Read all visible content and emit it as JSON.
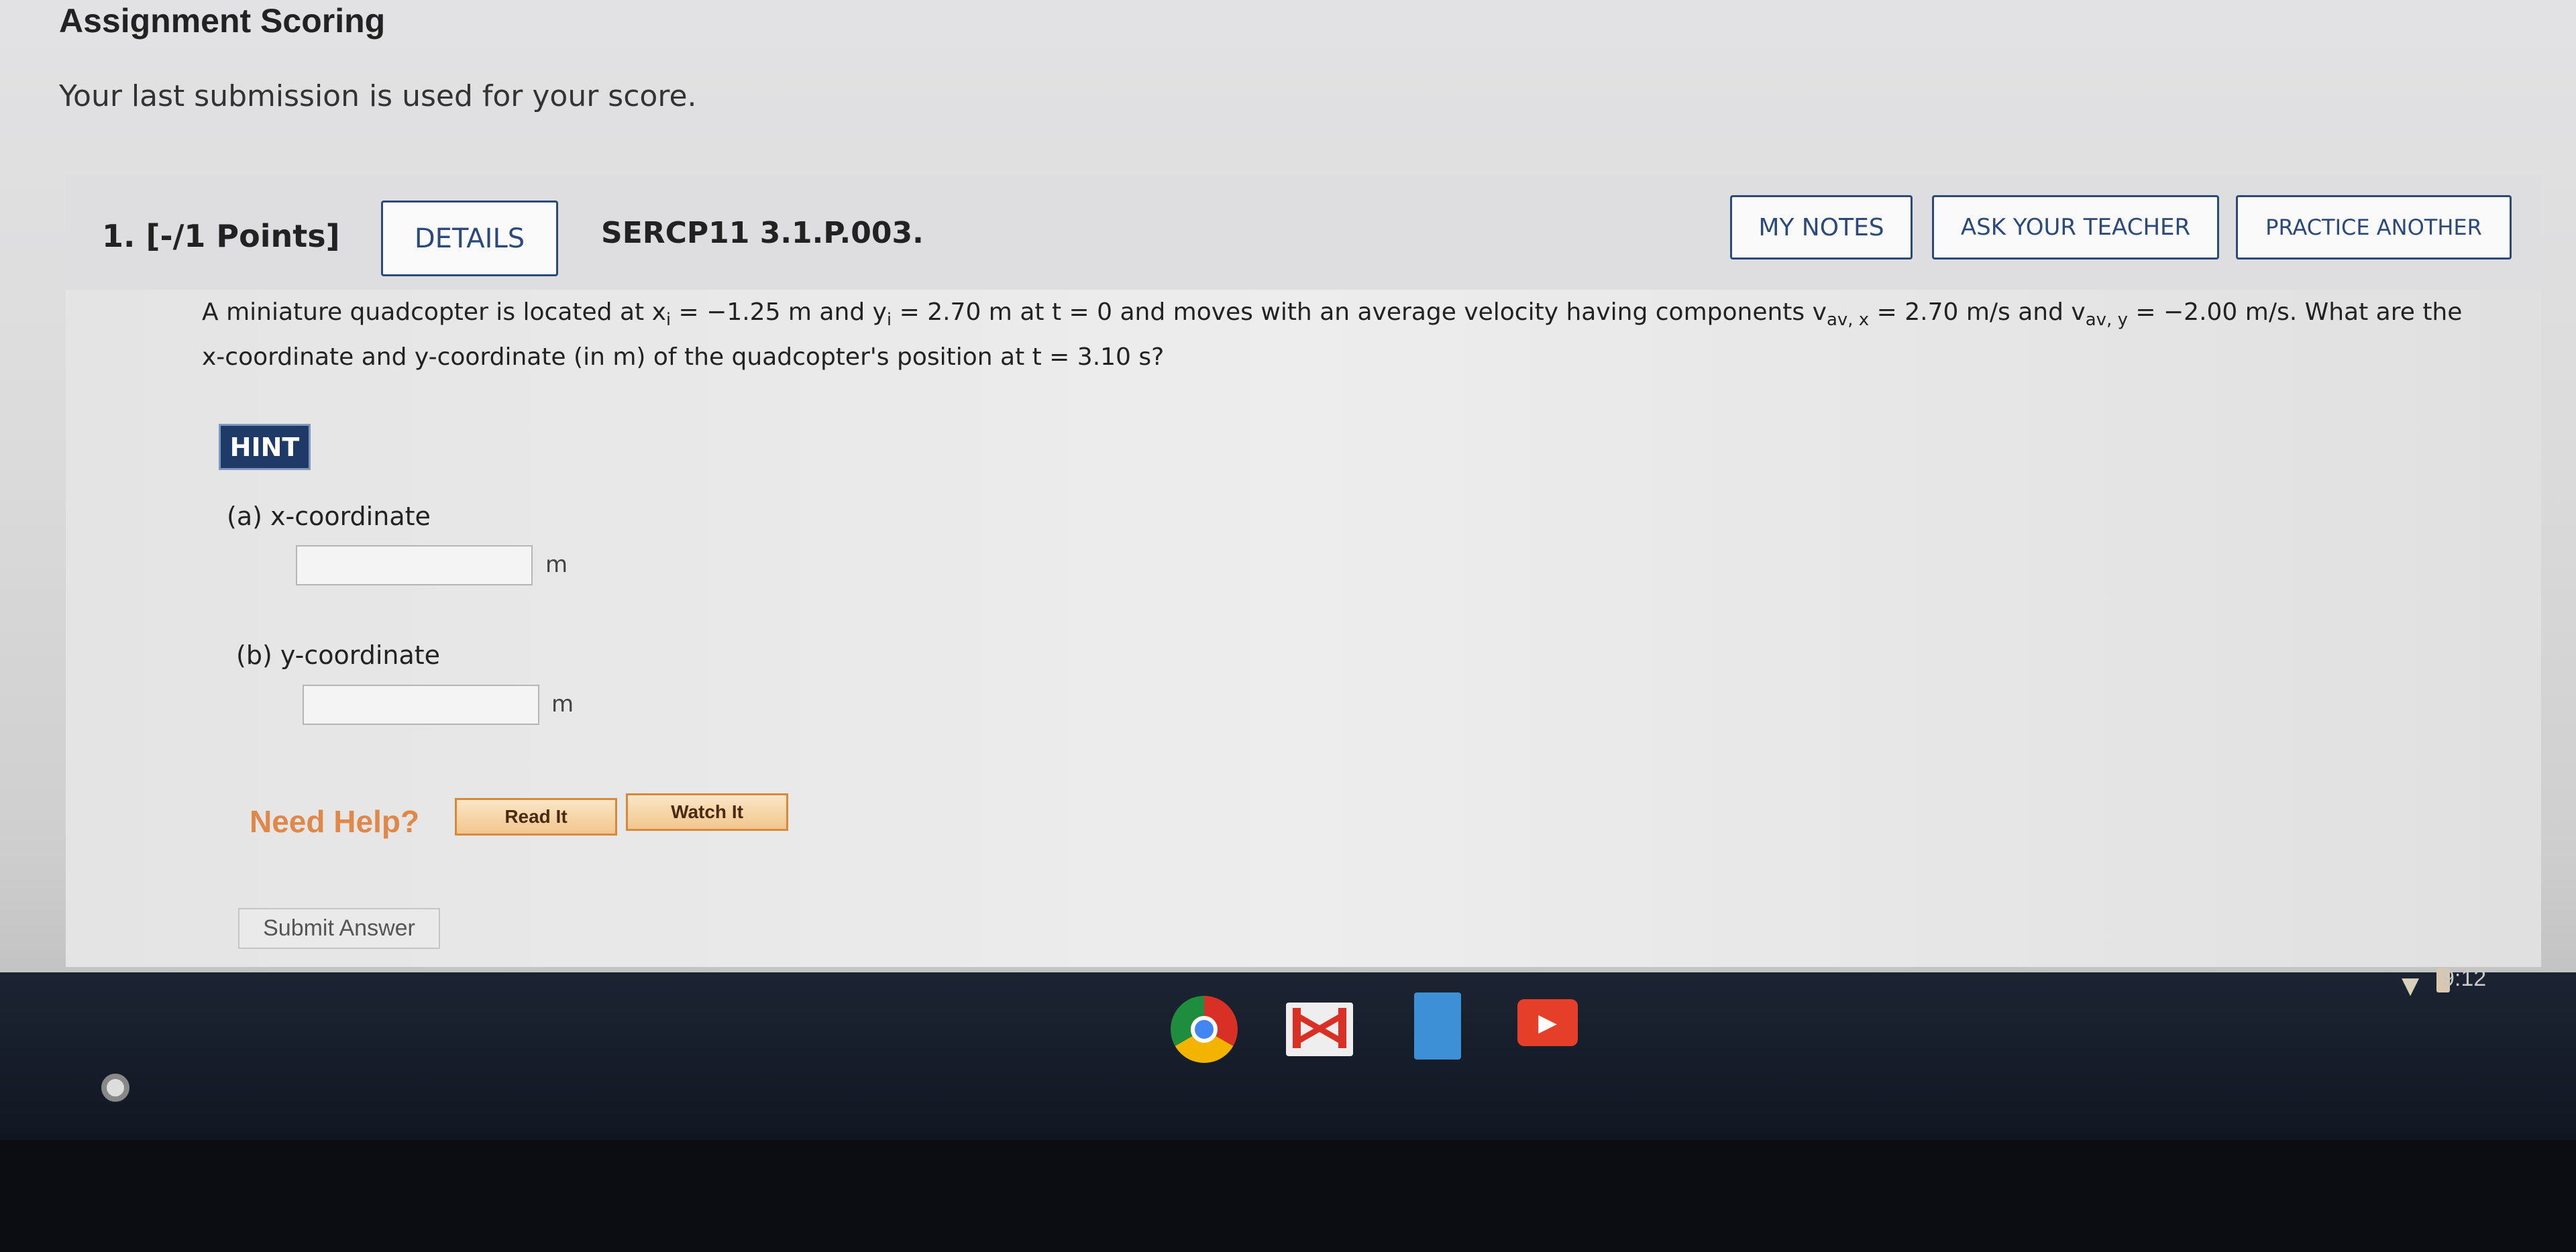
{
  "header": {
    "title": "Assignment Scoring",
    "subtitle": "Your last submission is used for your score."
  },
  "question": {
    "points": "1.  [-/1 Points]",
    "details_label": "DETAILS",
    "code": "SERCP11 3.1.P.003.",
    "my_notes_label": "MY NOTES",
    "ask_teacher_label": "ASK YOUR TEACHER",
    "practice_label": "PRACTICE ANOTHER",
    "text": {
      "p1": "A miniature quadcopter is located at x",
      "sub_i": "i",
      "p2": " = −1.25 m and y",
      "p3": " = 2.70 m at t = 0 and moves with an average velocity having components v",
      "sub_avx": "av, x",
      "p4": " = 2.70 m/s and v",
      "sub_avy": "av, y",
      "p5": " = −2.00 m/s. What are the",
      "line2": "x-coordinate and y-coordinate (in m) of the quadcopter's position at t = 3.10 s?"
    },
    "hint_label": "HINT",
    "parts": [
      {
        "label": "(a)   x-coordinate",
        "value": "",
        "unit": "m"
      },
      {
        "label": "(b)   y-coordinate",
        "value": "",
        "unit": "m"
      }
    ],
    "need_help": "Need Help?",
    "read_it": "Read It",
    "watch_it": "Watch It",
    "submit_label": "Submit Answer"
  },
  "taskbar": {
    "time": "9:12",
    "apps": [
      "chrome-icon",
      "gmail-icon",
      "docs-icon",
      "youtube-icon"
    ]
  }
}
